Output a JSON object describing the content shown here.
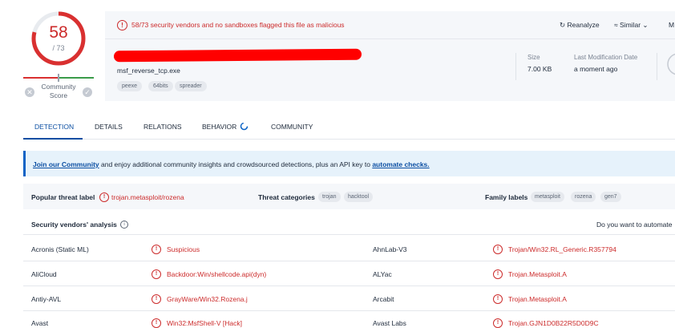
{
  "score": {
    "value": "58",
    "total": "/ 73",
    "label_line1": "Community",
    "label_line2": "Score"
  },
  "alert": {
    "text": "58/73 security vendors and no sandboxes flagged this file as malicious"
  },
  "actions": {
    "reanalyze": "Reanalyze",
    "similar": "Similar",
    "more": "M"
  },
  "file": {
    "name": "msf_reverse_tcp.exe",
    "tags": [
      "peexe",
      "64bits",
      "spreader"
    ],
    "size_label": "Size",
    "size_value": "7.00 KB",
    "modified_label": "Last Modification Date",
    "modified_value": "a moment ago"
  },
  "tabs": [
    "DETECTION",
    "DETAILS",
    "RELATIONS",
    "BEHAVIOR",
    "COMMUNITY"
  ],
  "banner": {
    "link1": "Join our Community",
    "middle": " and enjoy additional community insights and crowdsourced detections, plus an API key to ",
    "link2": "automate checks."
  },
  "threat": {
    "popular_label": "Popular threat label",
    "popular_value": "trojan.metasploit/rozena",
    "categories_label": "Threat categories",
    "categories": [
      "trojan",
      "hacktool"
    ],
    "family_label": "Family labels",
    "families": [
      "metasploit",
      "rozena",
      "gen7"
    ]
  },
  "vendors": {
    "title": "Security vendors' analysis",
    "right_text": "Do you want to automate",
    "rows": [
      {
        "left_name": "Acronis (Static ML)",
        "left_result": "Suspicious",
        "right_name": "AhnLab-V3",
        "right_result": "Trojan/Win32.RL_Generic.R357794"
      },
      {
        "left_name": "AliCloud",
        "left_result": "Backdoor:Win/shellcode.api(dyn)",
        "right_name": "ALYac",
        "right_result": "Trojan.Metasploit.A"
      },
      {
        "left_name": "Antiy-AVL",
        "left_result": "GrayWare/Win32.Rozena.j",
        "right_name": "Arcabit",
        "right_result": "Trojan.Metasploit.A"
      },
      {
        "left_name": "Avast",
        "left_result": "Win32:MsfShell-V [Hack]",
        "right_name": "Avast Labs",
        "right_result": "Trojan.GJN1D0B22R5D0D9C"
      }
    ]
  },
  "colors": {
    "malicious": "#cc2b2b",
    "accent": "#0b4ea2",
    "banner_bg": "#e6f2fb"
  }
}
